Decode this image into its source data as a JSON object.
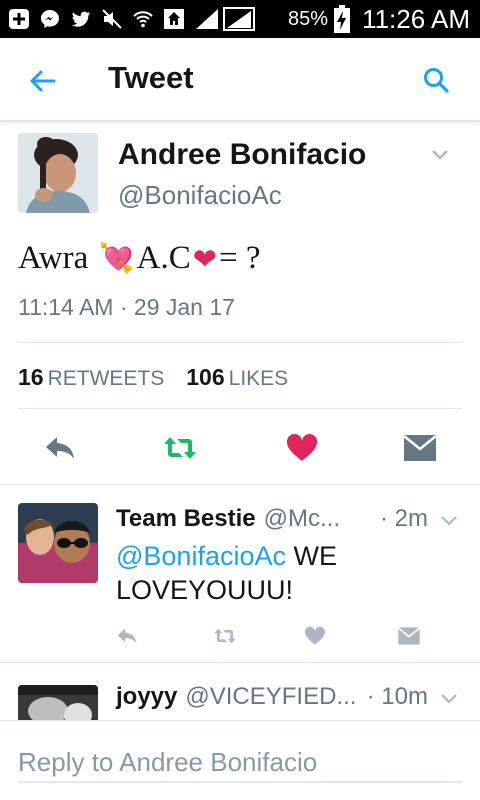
{
  "status_bar": {
    "battery_percent": "85%",
    "time": "11:26 AM",
    "icons": [
      "add-icon",
      "messenger-icon",
      "twitter-icon",
      "mute-icon",
      "wifi-icon",
      "home-icon",
      "signal-icon"
    ]
  },
  "app_bar": {
    "title": "Tweet",
    "accent_color": "#1da1f2"
  },
  "tweet": {
    "author_name": "Andree Bonifacio",
    "author_handle": "@BonifacioAc",
    "text_part1": "Awra ",
    "emoji1": "💘",
    "text_part2": "A.C",
    "emoji2": "❤",
    "text_part3": "= ?",
    "timestamp": "11:14 AM · 29 Jan 17",
    "retweet_count": "16",
    "retweet_label": "RETWEETS",
    "like_count": "106",
    "like_label": "LIKES",
    "liked": true,
    "like_color": "#e0245e",
    "retweet_color": "#17bf63"
  },
  "replies": [
    {
      "name": "Team Bestie",
      "handle": "@Mc...",
      "time": "· 2m",
      "mention": "@BonifacioAc",
      "text": " WE LOVEYOUUU!"
    },
    {
      "name": "joyyy",
      "handle": "@VICEYFIED...",
      "time": "· 10m"
    }
  ],
  "reply_bar": {
    "placeholder": "Reply to Andree Bonifacio"
  }
}
